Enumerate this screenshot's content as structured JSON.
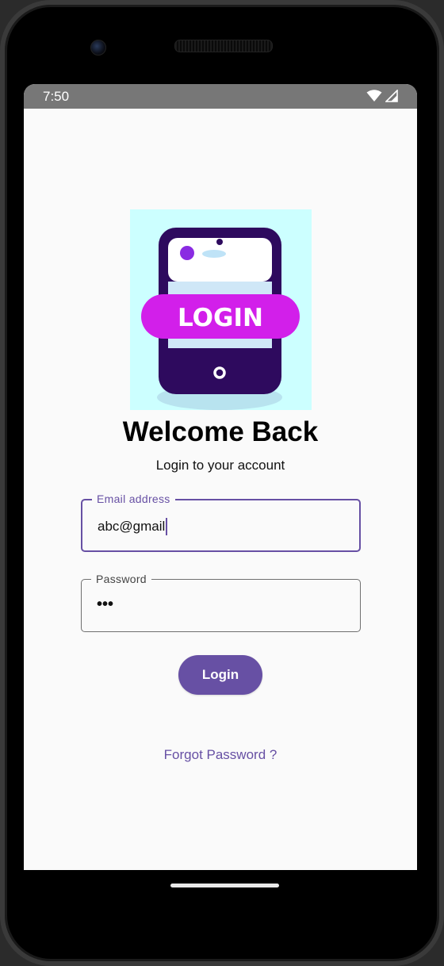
{
  "status_bar": {
    "time": "7:50",
    "icons": [
      "wifi-icon",
      "cellular-signal-icon"
    ]
  },
  "logo": {
    "icon": "phone-login-illustration",
    "text": "LOGIN"
  },
  "header": {
    "title": "Welcome Back",
    "subtitle": "Login to your account"
  },
  "form": {
    "email": {
      "label": "Email address",
      "value": "abc@gmail"
    },
    "password": {
      "label": "Password",
      "value": "•••"
    },
    "login_label": "Login",
    "forgot_label": "Forgot Password ?"
  },
  "colors": {
    "accent": "#6750a4",
    "status_bar": "#777777",
    "background": "#fafafa",
    "logo_bg": "#ccffff",
    "logo_phone": "#2e0a5e",
    "logo_banner": "#d21fea"
  }
}
